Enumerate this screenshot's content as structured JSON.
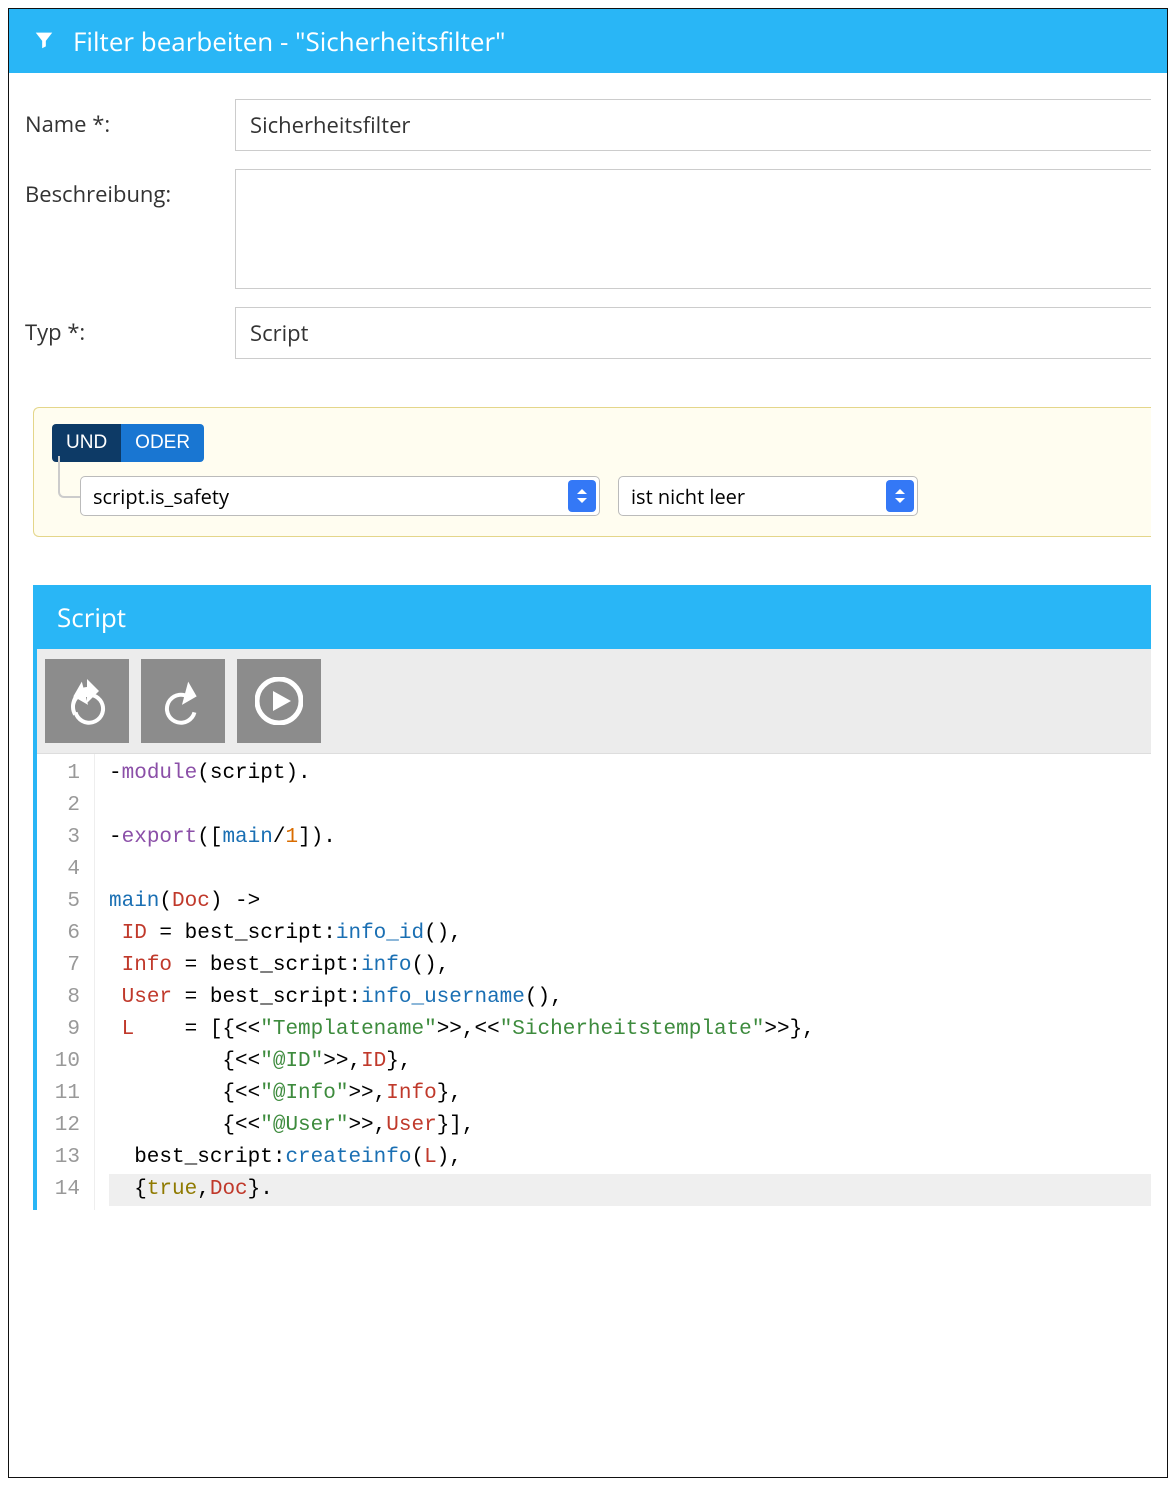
{
  "header": {
    "title": "Filter bearbeiten - \"Sicherheitsfilter\""
  },
  "form": {
    "name_label": "Name *:",
    "name_value": "Sicherheitsfilter",
    "desc_label": "Beschreibung:",
    "desc_value": "",
    "type_label": "Typ *:",
    "type_value": "Script"
  },
  "query": {
    "and_label": "UND",
    "or_label": "ODER",
    "rule_field": "script.is_safety",
    "rule_op": "ist nicht leer"
  },
  "script": {
    "panel_title": "Script",
    "toolbar": {
      "undo": "undo",
      "redo": "redo",
      "run": "run"
    },
    "code": [
      {
        "n": 1,
        "tokens": [
          [
            "-",
            ""
          ],
          [
            "module",
            "mod"
          ],
          [
            "(script).",
            ""
          ]
        ]
      },
      {
        "n": 2,
        "tokens": [
          [
            "",
            ""
          ]
        ]
      },
      {
        "n": 3,
        "tokens": [
          [
            "-",
            ""
          ],
          [
            "export",
            "mod"
          ],
          [
            "([",
            ""
          ],
          [
            "main",
            "fn"
          ],
          [
            "/",
            ""
          ],
          [
            "1",
            "num"
          ],
          [
            "]).",
            ""
          ]
        ]
      },
      {
        "n": 4,
        "tokens": [
          [
            "",
            ""
          ]
        ]
      },
      {
        "n": 5,
        "tokens": [
          [
            "main",
            "fn"
          ],
          [
            "(",
            ""
          ],
          [
            "Doc",
            "var"
          ],
          [
            ") ->",
            ""
          ]
        ]
      },
      {
        "n": 6,
        "tokens": [
          [
            " ",
            ""
          ],
          [
            "ID",
            "var"
          ],
          [
            " = best_script:",
            ""
          ],
          [
            "info_id",
            "fn"
          ],
          [
            "(),",
            ""
          ]
        ]
      },
      {
        "n": 7,
        "tokens": [
          [
            " ",
            ""
          ],
          [
            "Info",
            "var"
          ],
          [
            " = best_script:",
            ""
          ],
          [
            "info",
            "fn"
          ],
          [
            "(),",
            ""
          ]
        ]
      },
      {
        "n": 8,
        "tokens": [
          [
            " ",
            ""
          ],
          [
            "User",
            "var"
          ],
          [
            " = best_script:",
            ""
          ],
          [
            "info_username",
            "fn"
          ],
          [
            "(),",
            ""
          ]
        ]
      },
      {
        "n": 9,
        "tokens": [
          [
            " ",
            ""
          ],
          [
            "L",
            "var"
          ],
          [
            "    = [{<<",
            ""
          ],
          [
            "\"Templatename\"",
            "str"
          ],
          [
            ">>,<<",
            ""
          ],
          [
            "\"Sicherheitstemplate\"",
            "str"
          ],
          [
            ">>},",
            ""
          ]
        ]
      },
      {
        "n": 10,
        "tokens": [
          [
            "         {<<",
            ""
          ],
          [
            "\"@ID\"",
            "str"
          ],
          [
            ">>,",
            ""
          ],
          [
            "ID",
            "var"
          ],
          [
            "},",
            ""
          ]
        ]
      },
      {
        "n": 11,
        "tokens": [
          [
            "         {<<",
            ""
          ],
          [
            "\"@Info\"",
            "str"
          ],
          [
            ">>,",
            ""
          ],
          [
            "Info",
            "var"
          ],
          [
            "},",
            ""
          ]
        ]
      },
      {
        "n": 12,
        "tokens": [
          [
            "         {<<",
            ""
          ],
          [
            "\"@User\"",
            "str"
          ],
          [
            ">>,",
            ""
          ],
          [
            "User",
            "var"
          ],
          [
            "}],",
            ""
          ]
        ]
      },
      {
        "n": 13,
        "tokens": [
          [
            "  best_script:",
            ""
          ],
          [
            "createinfo",
            "fn"
          ],
          [
            "(",
            ""
          ],
          [
            "L",
            "var"
          ],
          [
            "),",
            ""
          ]
        ]
      },
      {
        "n": 14,
        "tokens": [
          [
            "  {",
            ""
          ],
          [
            "true",
            "kw"
          ],
          [
            ",",
            ""
          ],
          [
            "Doc",
            "var"
          ],
          [
            "}.",
            ""
          ]
        ],
        "current": true
      }
    ]
  }
}
